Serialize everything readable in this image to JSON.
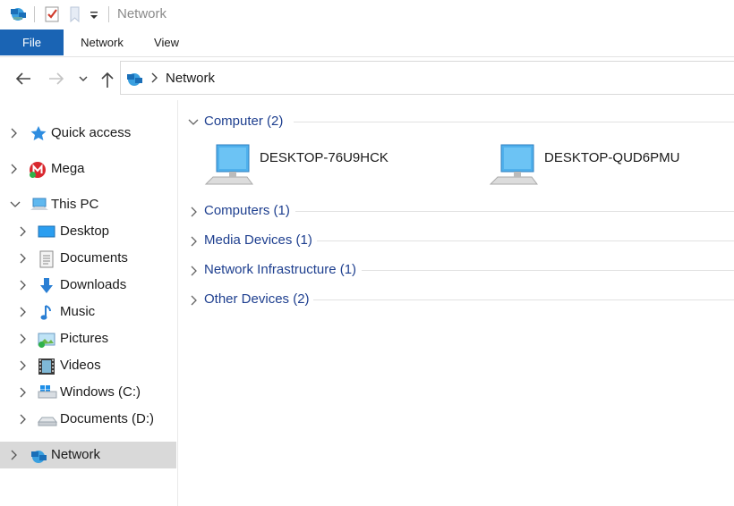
{
  "window": {
    "title": "Network"
  },
  "ribbon": {
    "tabs": [
      "File",
      "Network",
      "View"
    ]
  },
  "address": {
    "crumb": "Network"
  },
  "nav": {
    "items": [
      {
        "label": "Quick access",
        "icon": "star-icon"
      },
      {
        "label": "Mega",
        "icon": "mega-icon"
      },
      {
        "label": "This PC",
        "icon": "this-pc-icon"
      },
      {
        "label": "Desktop",
        "icon": "desktop-folder-icon"
      },
      {
        "label": "Documents",
        "icon": "documents-folder-icon"
      },
      {
        "label": "Downloads",
        "icon": "downloads-folder-icon"
      },
      {
        "label": "Music",
        "icon": "music-folder-icon"
      },
      {
        "label": "Pictures",
        "icon": "pictures-folder-icon"
      },
      {
        "label": "Videos",
        "icon": "videos-folder-icon"
      },
      {
        "label": "Windows (C:)",
        "icon": "windows-drive-icon"
      },
      {
        "label": "Documents (D:)",
        "icon": "drive-icon"
      },
      {
        "label": "Network",
        "icon": "network-icon"
      }
    ]
  },
  "content": {
    "groups": [
      {
        "label": "Computer (2)",
        "expanded": true
      },
      {
        "label": "Computers (1)",
        "expanded": false
      },
      {
        "label": "Media Devices (1)",
        "expanded": false
      },
      {
        "label": "Network Infrastructure (1)",
        "expanded": false
      },
      {
        "label": "Other Devices (2)",
        "expanded": false
      }
    ],
    "computers": [
      "DESKTOP-76U9HCK",
      "DESKTOP-QUD6PMU"
    ]
  },
  "colors": {
    "file_tab": "#1a64b4",
    "group_text": "#1e3f8f",
    "selected_nav": "#d9d9d9"
  }
}
